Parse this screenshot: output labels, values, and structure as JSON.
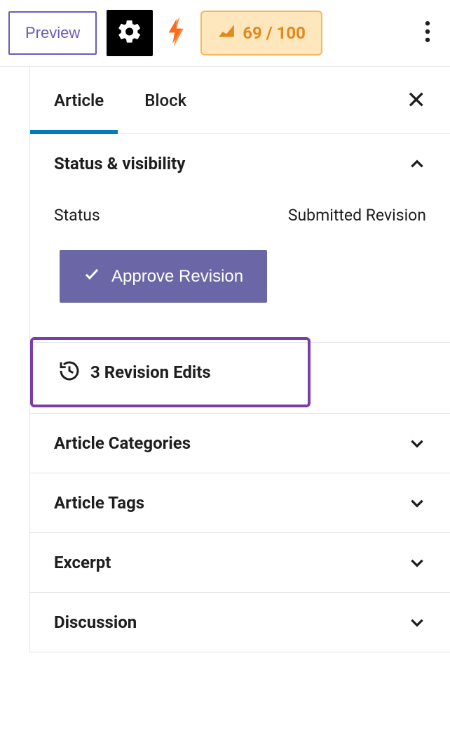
{
  "topbar": {
    "preview_label": "Preview",
    "score_text": "69 / 100"
  },
  "tabs": {
    "article": "Article",
    "block": "Block"
  },
  "status_panel": {
    "title": "Status & visibility",
    "status_label": "Status",
    "status_value": "Submitted Revision",
    "approve_label": "Approve Revision"
  },
  "revisions": {
    "label": "3 Revision Edits"
  },
  "sections": {
    "categories": "Article Categories",
    "tags": "Article Tags",
    "excerpt": "Excerpt",
    "discussion": "Discussion"
  }
}
